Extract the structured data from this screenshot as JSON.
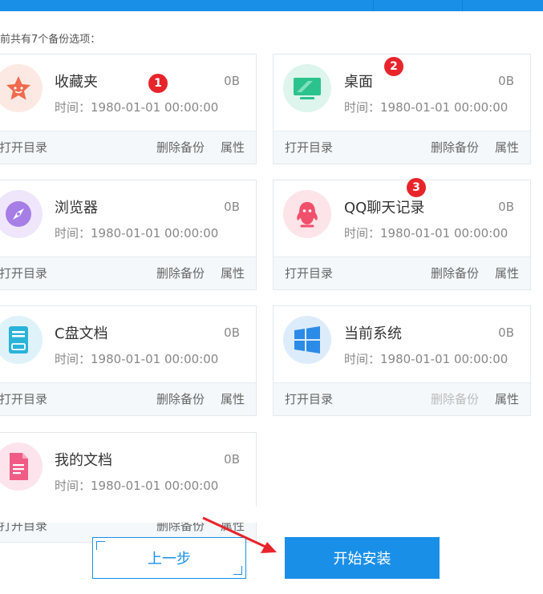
{
  "summary": "前共有7个备份选项：",
  "footer_labels": {
    "open": "打开目录",
    "delete": "删除备份",
    "properties": "属性"
  },
  "cards": [
    {
      "name": "收藏夹",
      "size": "0B",
      "time": "时间：1980-01-01 00:00:00",
      "icon": "star-icon",
      "delete_disabled": false,
      "color": "#f06a4e"
    },
    {
      "name": "桌面",
      "size": "0B",
      "time": "时间：1980-01-01 00:00:00",
      "icon": "monitor-icon",
      "delete_disabled": false,
      "color": "#2cc28e"
    },
    {
      "name": "浏览器",
      "size": "0B",
      "time": "时间：1980-01-01 00:00:00",
      "icon": "compass-icon",
      "delete_disabled": false,
      "color": "#a67ee6"
    },
    {
      "name": "QQ聊天记录",
      "size": "0B",
      "time": "时间：1980-01-01 00:00:00",
      "icon": "penguin-icon",
      "delete_disabled": false,
      "color": "#f0506c"
    },
    {
      "name": "C盘文档",
      "size": "0B",
      "time": "时间：1980-01-01 00:00:00",
      "icon": "drive-icon",
      "delete_disabled": false,
      "color": "#29b3d9"
    },
    {
      "name": "当前系统",
      "size": "0B",
      "time": "时间：1980-01-01 00:00:00",
      "icon": "windows-icon",
      "delete_disabled": true,
      "color": "#2b8be6"
    },
    {
      "name": "我的文档",
      "size": "0B",
      "time": "时间：1980-01-01 00:00:00",
      "icon": "document-icon",
      "delete_disabled": false,
      "color": "#f05c86"
    }
  ],
  "badges": [
    "1",
    "2",
    "3"
  ],
  "buttons": {
    "prev": "上一步",
    "start": "开始安装"
  },
  "colors": {
    "accent": "#1a8fe8",
    "badge": "#e8242b",
    "arrow": "#e8242b"
  }
}
